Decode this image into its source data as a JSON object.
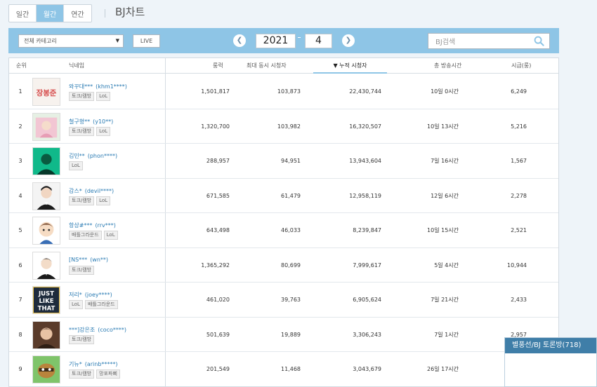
{
  "period_tabs": [
    {
      "label": "일간",
      "active": false
    },
    {
      "label": "월간",
      "active": true
    },
    {
      "label": "연간",
      "active": false
    }
  ],
  "page_title": "BJ차트",
  "toolbar": {
    "category_label": "전체 카테고리",
    "live_label": "LIVE",
    "prev_label": "❮",
    "next_label": "❯",
    "year": "2021",
    "month": "4",
    "search_placeholder": "BJ검색",
    "accent_color": "#8ec5e6"
  },
  "columns": {
    "rank": "순위",
    "nickname": "닉네임",
    "fans": "룽럭",
    "max_viewers": "최대 동시 시청자",
    "cumulative": "▼ 누적 시청자",
    "broadcast_time": "총 방송시간",
    "fee": "시급(룽)"
  },
  "rows": [
    {
      "rank": "1",
      "name": "와꾸대***",
      "uid": "(khm1****)",
      "tags": [
        "토크/캠방",
        "LoL"
      ],
      "fans": "1,501,817",
      "max": "103,873",
      "cum": "22,430,744",
      "time": "10일 0시간",
      "fee": "6,249"
    },
    {
      "rank": "2",
      "name": "철구형**",
      "uid": "(y10**)",
      "tags": [
        "토크/캠방",
        "LoL"
      ],
      "fans": "1,320,700",
      "max": "103,982",
      "cum": "16,320,507",
      "time": "10일 13시간",
      "fee": "5,216"
    },
    {
      "rank": "3",
      "name": "김민**",
      "uid": "(phon****)",
      "tags": [
        "LoL"
      ],
      "fans": "288,957",
      "max": "94,951",
      "cum": "13,943,604",
      "time": "7일 16시간",
      "fee": "1,567"
    },
    {
      "rank": "4",
      "name": "감스*",
      "uid": "(devil****)",
      "tags": [
        "토크/캠방",
        "LoL"
      ],
      "fans": "671,585",
      "max": "61,479",
      "cum": "12,958,119",
      "time": "12일 6시간",
      "fee": "2,278"
    },
    {
      "rank": "5",
      "name": "항상#***",
      "uid": "(rrv***)",
      "tags": [
        "배틀그라운드",
        "LoL"
      ],
      "fans": "643,498",
      "max": "46,033",
      "cum": "8,239,847",
      "time": "10일 15시간",
      "fee": "2,521"
    },
    {
      "rank": "6",
      "name": "[NS***",
      "uid": "(wn**)",
      "tags": [
        "토크/캠방"
      ],
      "fans": "1,365,292",
      "max": "80,699",
      "cum": "7,999,617",
      "time": "5일 4시간",
      "fee": "10,944"
    },
    {
      "rank": "7",
      "name": "저리*",
      "uid": "(joey****)",
      "tags": [
        "LoL",
        "배틀그라운드"
      ],
      "fans": "461,020",
      "max": "39,763",
      "cum": "6,905,624",
      "time": "7일 21시간",
      "fee": "2,433"
    },
    {
      "rank": "8",
      "name": "***]강은조",
      "uid": "(coco****)",
      "tags": [
        "토크/캠방"
      ],
      "fans": "501,639",
      "max": "19,889",
      "cum": "3,306,243",
      "time": "7일 1시간",
      "fee": "2,957"
    },
    {
      "rank": "9",
      "name": "기뉴*",
      "uid": "(arinb*****)",
      "tags": [
        "토크/캠방",
        "망포파삐"
      ],
      "fans": "201,549",
      "max": "11,468",
      "cum": "3,043,679",
      "time": "26일 17시간",
      "fee": ""
    }
  ],
  "avatar_1_text": "장봉준",
  "avatar_7_lines": [
    "JUST",
    "LIKE",
    "THAT"
  ],
  "popup": {
    "title": "별풍선/BJ 토론방(718)"
  }
}
